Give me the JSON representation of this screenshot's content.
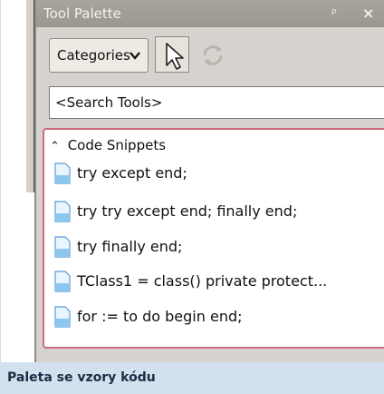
{
  "window": {
    "title": "Tool Palette",
    "pin_glyph": "ᵖ",
    "close_glyph": "×"
  },
  "toolbar": {
    "categories_label": "Categories",
    "pointer_icon": "arrow-cursor-icon",
    "refresh_icon": "refresh-icon"
  },
  "search": {
    "value": "<Search Tools>"
  },
  "category": {
    "collapse_glyph": "⌃",
    "name": "Code Snippets"
  },
  "snippets": [
    {
      "label": "try except end;"
    },
    {
      "label": "try  try  except  end; finally end;"
    },
    {
      "label": "try finally end;"
    },
    {
      "label": "TClass1 = class() private protect..."
    },
    {
      "label": "for := to do begin end;"
    }
  ],
  "caption": "Paleta se vzory kódu",
  "colors": {
    "caption_bg": "#d3e1ee",
    "category_border": "#c96b7d",
    "palette_bg": "#d6d3ce"
  }
}
